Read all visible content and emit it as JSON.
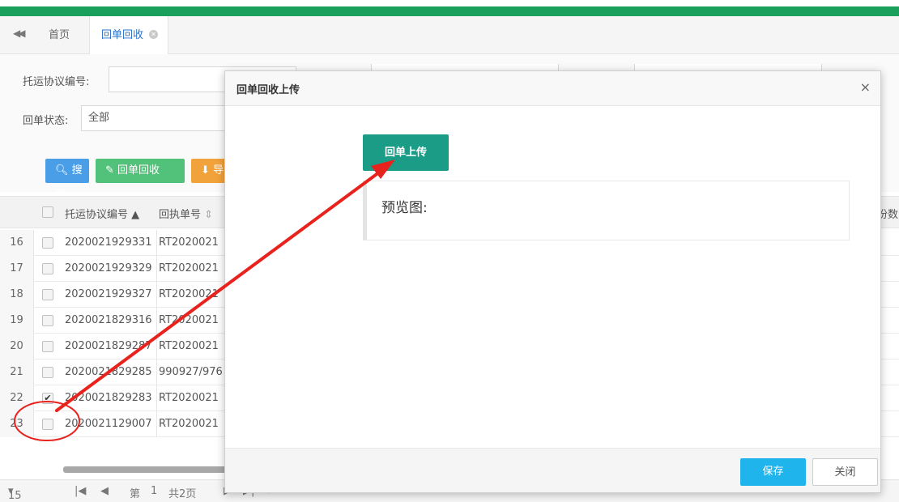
{
  "tabs": {
    "collapse_icon": "double-chevron-left-icon",
    "home": "首页",
    "active": "回单回收"
  },
  "filter": {
    "contract_no_label": "托运协议编号:",
    "contract_no_value": "",
    "status_label": "回单状态:",
    "status_value": "全部"
  },
  "toolbar": {
    "search": "搜索",
    "recover": "回单回收",
    "export": "导"
  },
  "grid": {
    "headers": [
      "托运协议编号",
      "回执单号",
      "份数"
    ],
    "rows": [
      {
        "num": "16",
        "checked": false,
        "a": "2020021929331",
        "b": "RT2020021"
      },
      {
        "num": "17",
        "checked": false,
        "a": "2020021929329",
        "b": "RT2020021"
      },
      {
        "num": "18",
        "checked": false,
        "a": "2020021929327",
        "b": "RT2020021"
      },
      {
        "num": "19",
        "checked": false,
        "a": "2020021829316",
        "b": "RT2020021"
      },
      {
        "num": "20",
        "checked": false,
        "a": "2020021829287",
        "b": "RT2020021"
      },
      {
        "num": "21",
        "checked": false,
        "a": "2020021829285",
        "b": "990927/976"
      },
      {
        "num": "22",
        "checked": true,
        "a": "2020021829283",
        "b": "RT2020021"
      },
      {
        "num": "23",
        "checked": false,
        "a": "2020021129007",
        "b": "RT2020021"
      }
    ]
  },
  "pager": {
    "page_size": "15",
    "page_prefix": "第",
    "page_current": "1",
    "page_total": "共2页"
  },
  "dialog": {
    "title": "回单回收上传",
    "upload_button": "回单上传",
    "preview_label": "预览图:",
    "save": "保存",
    "close": "关闭"
  },
  "colors": {
    "brand_green": "#1aa05a",
    "upload_teal": "#1a9c86",
    "save_blue": "#1fb5ec",
    "annotation_red": "#e8231e"
  }
}
